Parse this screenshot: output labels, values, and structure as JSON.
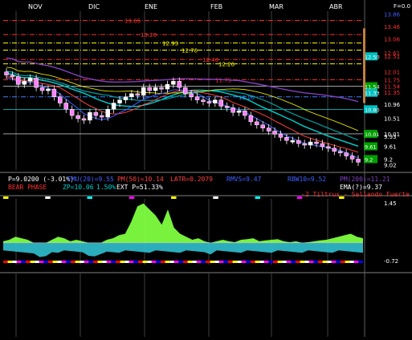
{
  "chart_data": [
    {
      "type": "candlestick",
      "x_ticks": [
        "NOV",
        "DIC",
        "ENE",
        "FEB",
        "MAR",
        "ABR"
      ],
      "y_ticks": [
        "13.86",
        "13.46",
        "13.06",
        "12.61",
        "12.51",
        "12.01",
        "11.75",
        "11.54",
        "11.35",
        "10.96",
        "10.51",
        "10.01",
        "9.93",
        "9.61",
        "9.2",
        "9.02"
      ],
      "ylim": [
        8.85,
        13.95
      ],
      "level_lines": [
        {
          "label": "13.65",
          "value": 13.65,
          "color": "#ff3030"
        },
        {
          "label": "13.20",
          "value": 13.2,
          "color": "#ff3030"
        },
        {
          "label": "12.93",
          "value": 12.93,
          "color": "#ffff00"
        },
        {
          "label": "12.70",
          "value": 12.7,
          "color": "#ffff00"
        },
        {
          "label": "12.40",
          "value": 12.4,
          "color": "#ff3030"
        },
        {
          "label": "12.26",
          "value": 12.26,
          "color": "#ffff00"
        },
        {
          "label": "11.75",
          "value": 11.75,
          "color": "#ff3030"
        },
        {
          "label": "11.20",
          "value": 11.2,
          "color": "#4080ff"
        }
      ],
      "price_tags": [
        {
          "label": "12.50",
          "value": 12.5,
          "color": "#00c0c0"
        },
        {
          "label": "11.54",
          "value": 11.54,
          "color": "#00a000"
        },
        {
          "label": "11.33",
          "value": 11.33,
          "color": "#00c0c0"
        },
        {
          "label": "10.80",
          "value": 10.8,
          "color": "#00c0c0"
        },
        {
          "label": "10.01",
          "value": 10.01,
          "color": "#00a000"
        },
        {
          "label": "9.61",
          "value": 9.61,
          "color": "#00a000"
        },
        {
          "label": "9.2",
          "value": 9.2,
          "color": "#00a000"
        }
      ],
      "corner_label": "F=0.0",
      "closes": [
        11.9,
        11.85,
        11.6,
        11.7,
        11.8,
        11.5,
        11.4,
        11.45,
        11.2,
        11.0,
        10.8,
        10.6,
        10.5,
        10.45,
        10.7,
        10.6,
        10.55,
        10.8,
        11.0,
        11.1,
        11.2,
        11.3,
        11.25,
        11.5,
        11.4,
        11.5,
        11.45,
        11.6,
        11.7,
        11.5,
        11.3,
        11.2,
        11.1,
        11.05,
        11.0,
        11.1,
        10.9,
        10.85,
        10.7,
        10.75,
        10.6,
        10.4,
        10.3,
        10.2,
        10.1,
        10.0,
        9.9,
        9.8,
        9.8,
        9.7,
        9.65,
        9.75,
        9.7,
        9.6,
        9.55,
        9.45,
        9.4,
        9.3,
        9.2,
        9.1
      ],
      "series_colors": [
        "#00d0d0",
        "#00a0a0",
        "#8040c0",
        "#ff4040",
        "#ffff00",
        "#4060ff"
      ]
    },
    {
      "type": "area",
      "ylim": [
        -0.72,
        1.45
      ],
      "y_ticks": [
        "1.45",
        "-0.72"
      ],
      "values": [
        0.05,
        0.1,
        0.2,
        0.15,
        0.1,
        -0.1,
        -0.2,
        -0.15,
        0.1,
        0.2,
        0.15,
        0.05,
        0.1,
        0.05,
        -0.1,
        -0.2,
        -0.1,
        0.1,
        0.15,
        0.25,
        0.3,
        0.7,
        1.2,
        1.3,
        1.1,
        0.9,
        0.6,
        1.1,
        0.5,
        0.3,
        0.2,
        0.1,
        0.15,
        0.05,
        -0.05,
        0.05,
        0.1,
        0.05,
        0.02,
        0.1,
        0.12,
        0.15,
        0.05,
        0.08,
        0.1,
        0.12,
        0.05,
        0.02,
        0.05,
        0.0,
        0.02,
        0.05,
        0.08,
        0.1,
        0.15,
        0.2,
        0.25,
        0.3,
        0.2,
        0.15
      ]
    }
  ],
  "indicators": {
    "row1": [
      {
        "text": "P=9.0200 (-3.01%)",
        "color": "#ffffff"
      },
      {
        "text": "FMU(20)=9.55",
        "color": "#4060ff"
      },
      {
        "text": "PM(50)=10.14",
        "color": "#ff4040"
      },
      {
        "text": "LATR=0.2079",
        "color": "#ff4040"
      },
      {
        "text": "RMVS=9.47",
        "color": "#4060ff"
      },
      {
        "text": "RBW10=9.52",
        "color": "#4060ff"
      },
      {
        "text": "PM(200)=11.21",
        "color": "#8040c0"
      }
    ],
    "row2": [
      {
        "text": "BEAR PHASE",
        "color": "#ff3030"
      },
      {
        "text": "ZP=10.06",
        "color": "#00d0d0"
      },
      {
        "text": "1.50%",
        "color": "#00d0d0"
      },
      {
        "text": "EXT P=51.33%",
        "color": "#ffffff"
      },
      {
        "text": "EMA(?)=9.37",
        "color": "#ffffff"
      }
    ],
    "row3": [
      {
        "text": "-2 Tiltrus - Sallando Fuerte",
        "color": "#ff3030"
      }
    ]
  }
}
